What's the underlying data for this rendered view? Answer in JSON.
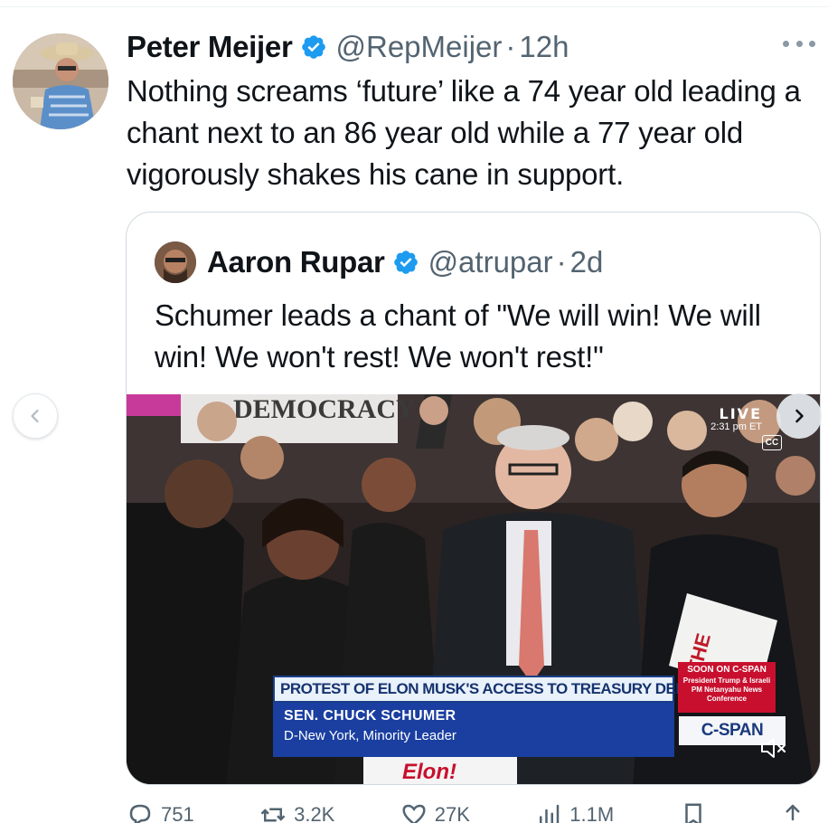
{
  "tweet": {
    "author_name": "Peter Meijer",
    "author_handle": "@RepMeijer",
    "separator": "·",
    "time": "12h",
    "text": "Nothing screams ‘future’ like a 74 year old leading a chant next to an 86 year old while a 77 year old vigorously shakes his cane in support."
  },
  "quote": {
    "author_name": "Aaron Rupar",
    "author_handle": "@atrupar",
    "separator": "·",
    "time": "2d",
    "text": "Schumer leads a chant of \"We will win! We will win! We won't rest! We won't rest!\""
  },
  "video": {
    "live_label": "LIVE",
    "live_time": "2:31 pm ET",
    "cc_label": "CC",
    "chyron_headline": "PROTEST OF ELON MUSK'S ACCESS TO TREASURY DEPT.",
    "chyron_name": "SEN. CHUCK SCHUMER",
    "chyron_title": "D-New York, Minority Leader",
    "soon_header": "SOON ON C-SPAN",
    "soon_body": "President Trump & Israeli PM Netanyahu News Conference",
    "network_logo": "C-SPAN",
    "sign_top": "DEMOCRACY",
    "sign_bottom": "Elon!"
  },
  "actions": {
    "replies": "751",
    "reposts": "3.2K",
    "likes": "27K",
    "views": "1.1M"
  },
  "colors": {
    "verified": "#1d9bf0",
    "text": "#0f1419",
    "secondary": "#536471",
    "chyron_blue": "#1a3fa0",
    "cspan_red": "#c8102e"
  }
}
